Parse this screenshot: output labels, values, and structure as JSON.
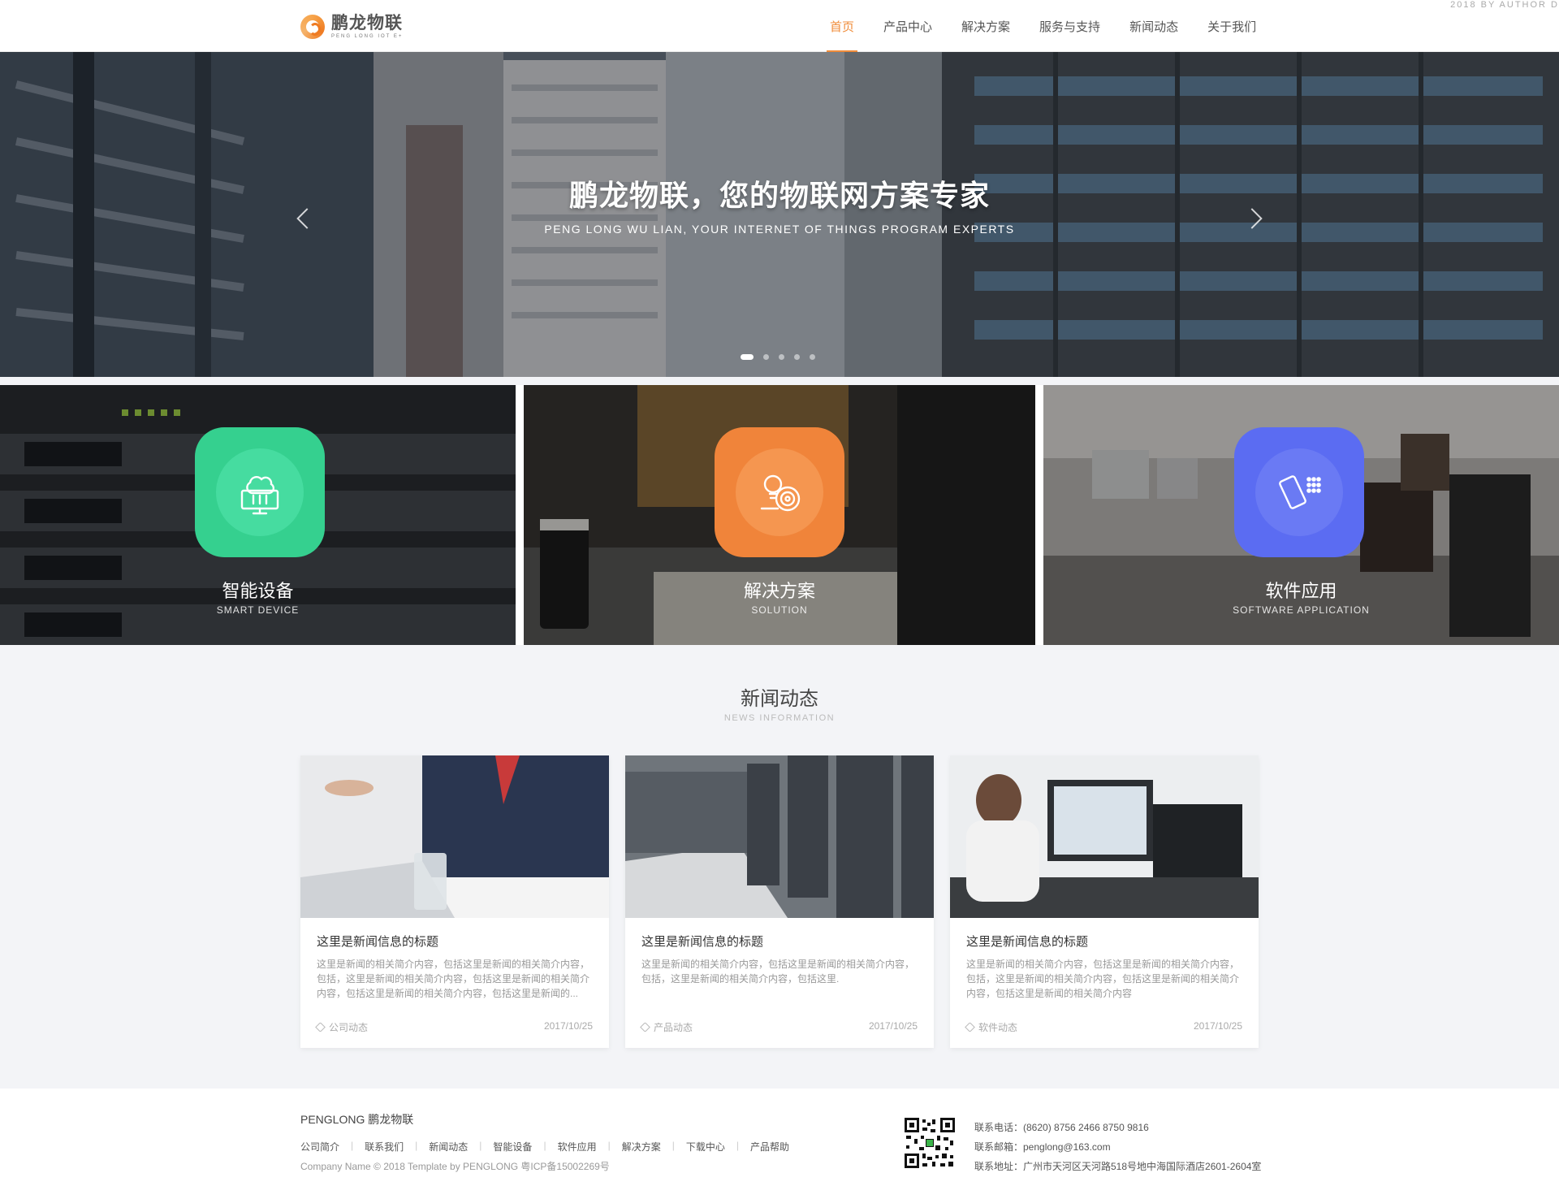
{
  "header": {
    "logo_cn": "鹏龙物联",
    "logo_en": "PENG LONG IOT E+",
    "corner_text": "2018 BY AUTHOR D",
    "nav": [
      {
        "label": "首页",
        "active": true
      },
      {
        "label": "产品中心",
        "active": false
      },
      {
        "label": "解决方案",
        "active": false
      },
      {
        "label": "服务与支持",
        "active": false
      },
      {
        "label": "新闻动态",
        "active": false
      },
      {
        "label": "关于我们",
        "active": false
      }
    ]
  },
  "hero": {
    "title": "鹏龙物联，您的物联网方案专家",
    "subtitle": "PENG LONG WU LIAN, YOUR INTERNET OF THINGS PROGRAM EXPERTS",
    "active_slide": 1,
    "slide_count": 5
  },
  "features": [
    {
      "title": "智能设备",
      "subtitle": "SMART DEVICE",
      "icon": "cloud-computer-icon",
      "color": "#35d08f"
    },
    {
      "title": "解决方案",
      "subtitle": "SOLUTION",
      "icon": "lightbulb-target-icon",
      "color": "#f0843a"
    },
    {
      "title": "软件应用",
      "subtitle": "SOFTWARE APPLICATION",
      "icon": "mobile-phone-icon",
      "color": "#5b6cf2"
    }
  ],
  "news": {
    "title": "新闻动态",
    "subtitle": "NEWS INFORMATION",
    "cards": [
      {
        "title": "这里是新闻信息的标题",
        "excerpt": "这里是新闻的相关简介内容，包括这里是新闻的相关简介内容，包括，这里是新闻的相关简介内容，包括这里是新闻的相关简介内容，包括这里是新闻的相关简介内容，包括这里是新闻的...",
        "category": "公司动态",
        "date": "2017/10/25"
      },
      {
        "title": "这里是新闻信息的标题",
        "excerpt": "这里是新闻的相关简介内容，包括这里是新闻的相关简介内容，包括，这里是新闻的相关简介内容，包括这里.",
        "category": "产品动态",
        "date": "2017/10/25"
      },
      {
        "title": "这里是新闻信息的标题",
        "excerpt": "这里是新闻的相关简介内容，包括这里是新闻的相关简介内容，包括，这里是新闻的相关简介内容，包括这里是新闻的相关简介内容，包括这里是新闻的相关简介内容",
        "category": "软件动态",
        "date": "2017/10/25"
      }
    ]
  },
  "footer": {
    "brand": "PENGLONG 鹏龙物联",
    "links": [
      "公司简介",
      "联系我们",
      "新闻动态",
      "智能设备",
      "软件应用",
      "解决方案",
      "下载中心",
      "产品帮助"
    ],
    "copyright": "Company Name © 2018 Template by PENGLONG 粤ICP备15002269号",
    "phone": "联系电话：(8620) 8756 2466  8750 9816",
    "email": "联系邮箱：penglong@163.com",
    "address": "联系地址：广州市天河区天河路518号地中海国际酒店2601-2604室"
  },
  "colors": {
    "accent": "#f08c3a",
    "green": "#35d08f",
    "orange": "#f0843a",
    "blue": "#5b6cf2"
  }
}
